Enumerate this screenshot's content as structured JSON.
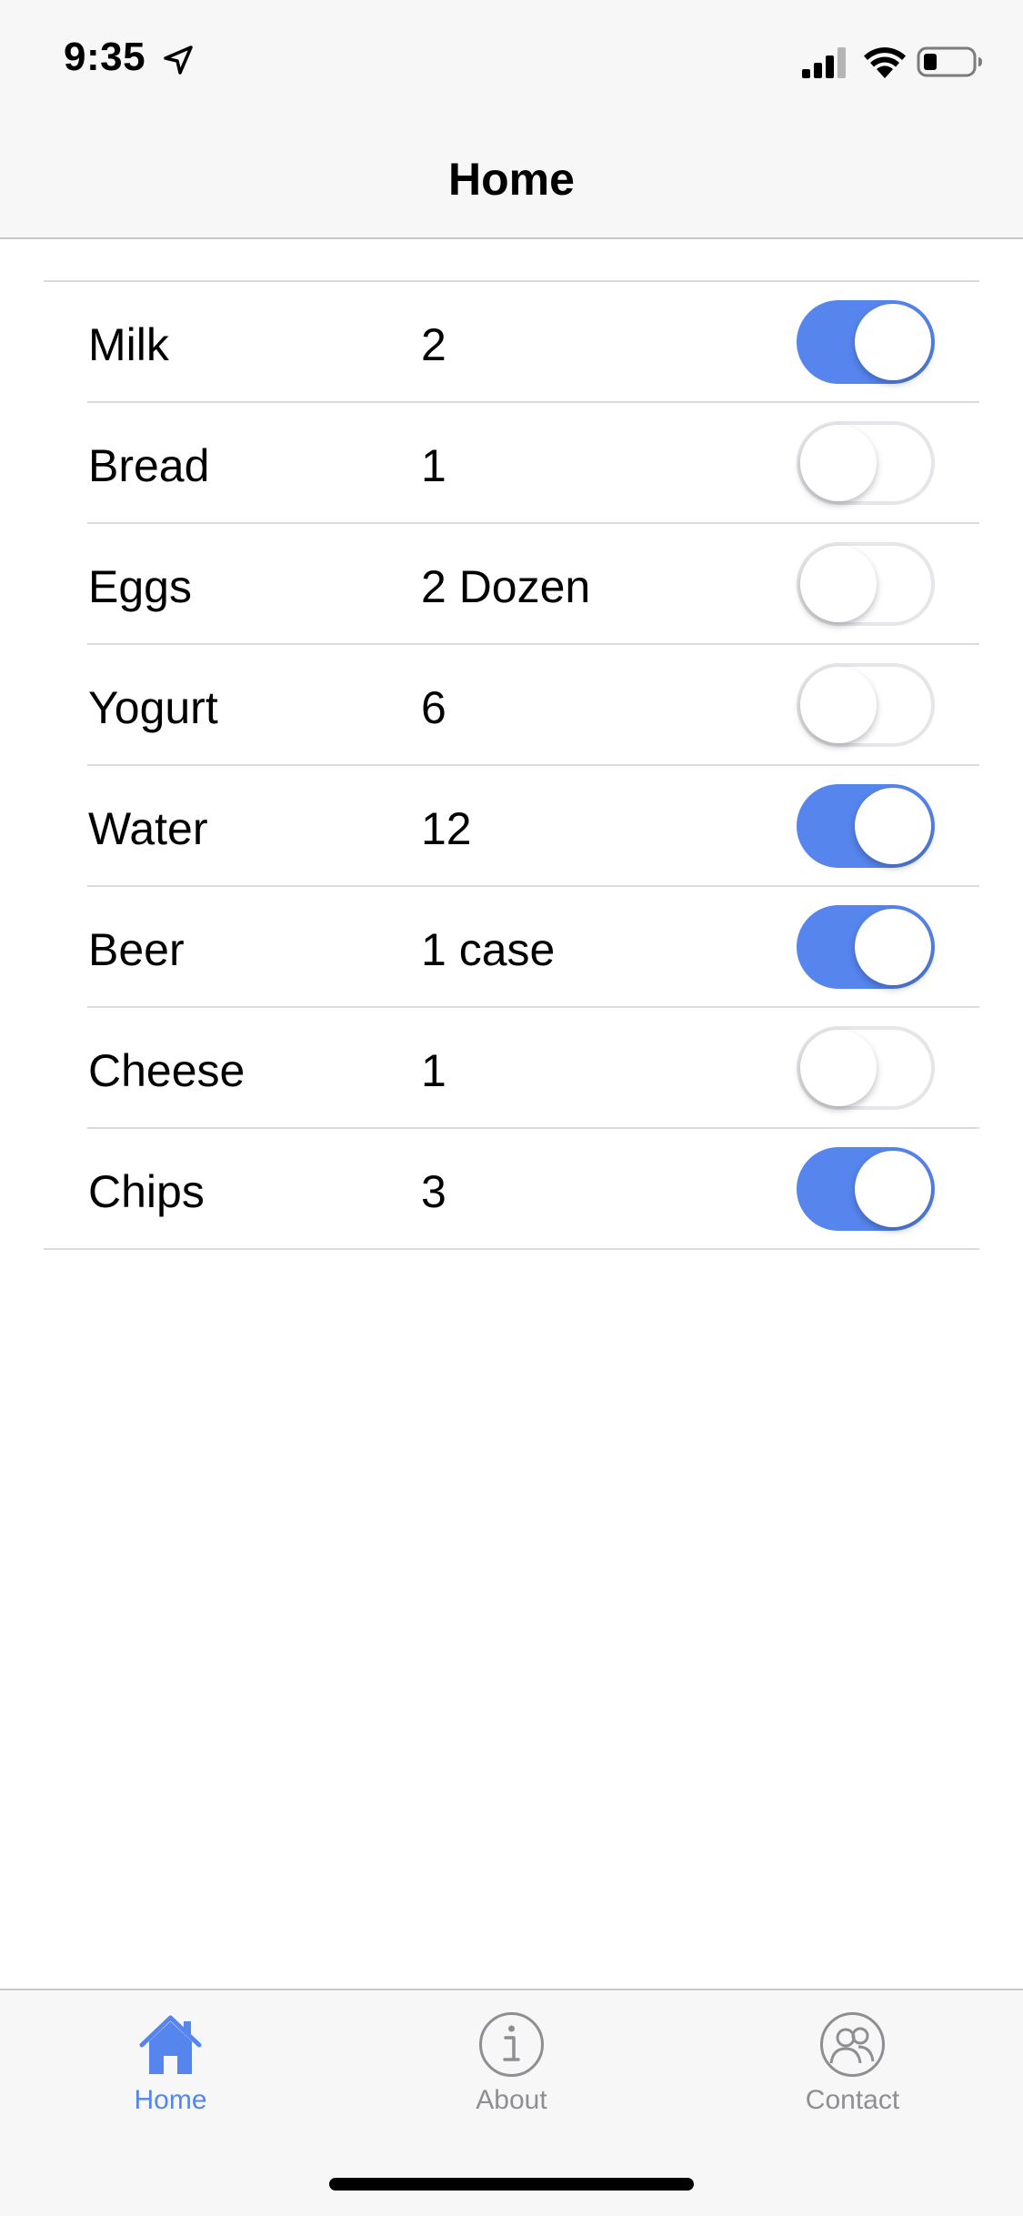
{
  "status_bar": {
    "time": "9:35",
    "icons": [
      "location-arrow-icon",
      "cellular-signal-icon",
      "wifi-icon",
      "battery-icon"
    ]
  },
  "nav": {
    "title": "Home"
  },
  "colors": {
    "accent": "#5685ee",
    "toggle_off_border": "#e5e5ea",
    "inactive_tab": "#8e8e93",
    "bar_background": "#f7f7f7"
  },
  "items": [
    {
      "name": "Milk",
      "quantity": "2",
      "on": true
    },
    {
      "name": "Bread",
      "quantity": "1",
      "on": false
    },
    {
      "name": "Eggs",
      "quantity": "2 Dozen",
      "on": false
    },
    {
      "name": "Yogurt",
      "quantity": "6",
      "on": false
    },
    {
      "name": "Water",
      "quantity": "12",
      "on": true
    },
    {
      "name": "Beer",
      "quantity": "1 case",
      "on": true
    },
    {
      "name": "Cheese",
      "quantity": "1",
      "on": false
    },
    {
      "name": "Chips",
      "quantity": "3",
      "on": true
    }
  ],
  "tabs": [
    {
      "label": "Home",
      "icon": "house-icon",
      "active": true
    },
    {
      "label": "About",
      "icon": "info-circle-icon",
      "active": false
    },
    {
      "label": "Contact",
      "icon": "contacts-icon",
      "active": false
    }
  ]
}
